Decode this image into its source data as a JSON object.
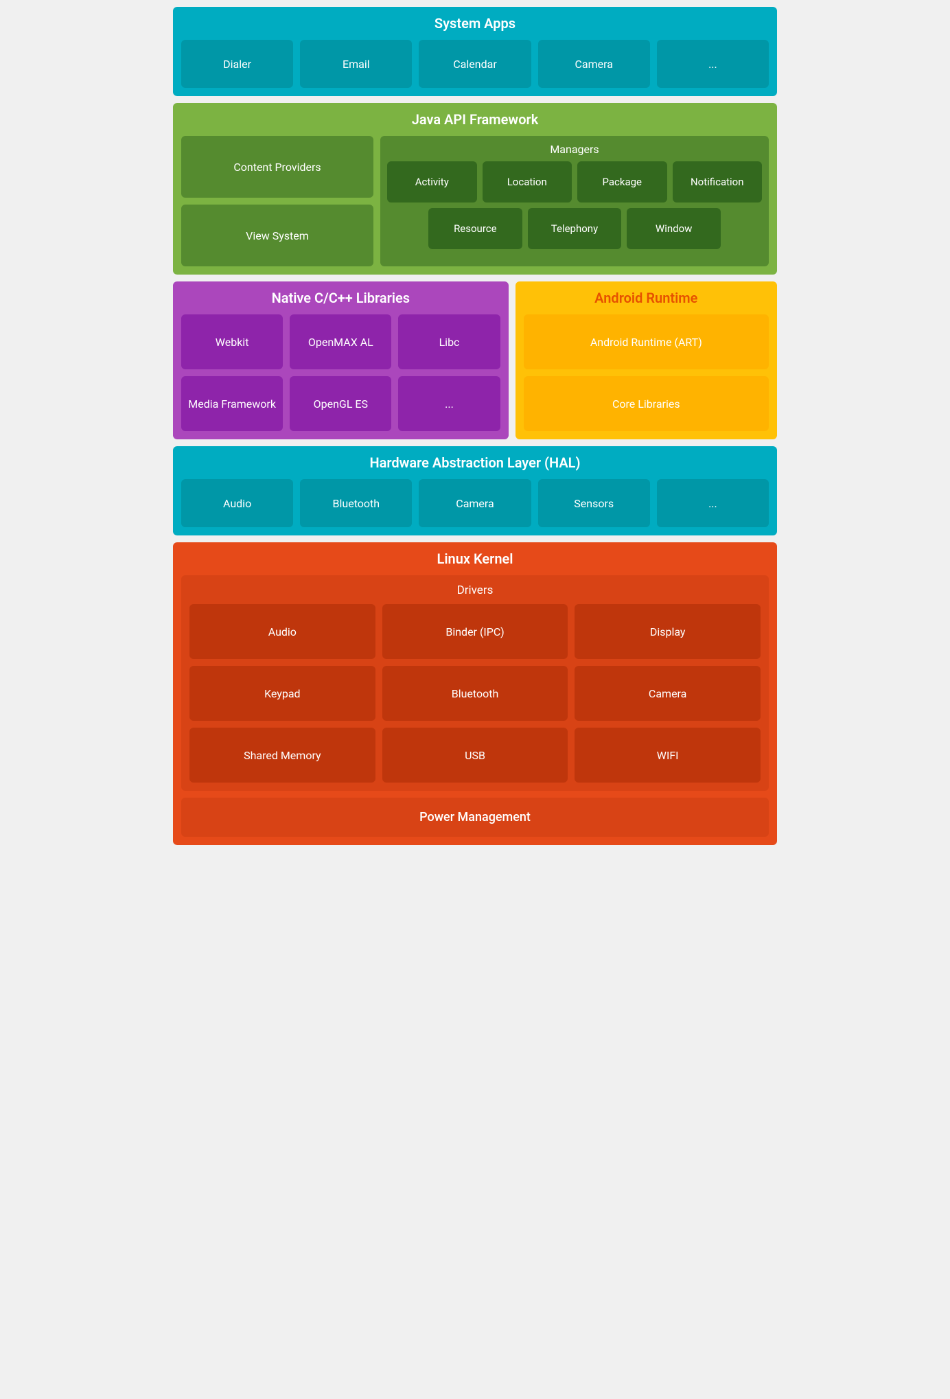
{
  "systemApps": {
    "title": "System Apps",
    "cards": [
      "Dialer",
      "Email",
      "Calendar",
      "Camera",
      "..."
    ]
  },
  "javaApi": {
    "title": "Java API Framework",
    "leftCards": [
      "Content Providers",
      "View System"
    ],
    "managers": {
      "title": "Managers",
      "row1": [
        "Activity",
        "Location",
        "Package",
        "Notification"
      ],
      "row2": [
        "Resource",
        "Telephony",
        "Window"
      ]
    }
  },
  "nativeLibs": {
    "title": "Native C/C++ Libraries",
    "cards": [
      "Webkit",
      "OpenMAX AL",
      "Libc",
      "Media Framework",
      "OpenGL ES",
      "..."
    ]
  },
  "androidRuntime": {
    "title": "Android Runtime",
    "cards": [
      "Android Runtime (ART)",
      "Core Libraries"
    ]
  },
  "hal": {
    "title": "Hardware Abstraction Layer (HAL)",
    "cards": [
      "Audio",
      "Bluetooth",
      "Camera",
      "Sensors",
      "..."
    ]
  },
  "linuxKernel": {
    "title": "Linux Kernel",
    "drivers": {
      "title": "Drivers",
      "cards": [
        "Audio",
        "Binder (IPC)",
        "Display",
        "Keypad",
        "Bluetooth",
        "Camera",
        "Shared Memory",
        "USB",
        "WIFI"
      ]
    },
    "powerManagement": "Power Management"
  }
}
